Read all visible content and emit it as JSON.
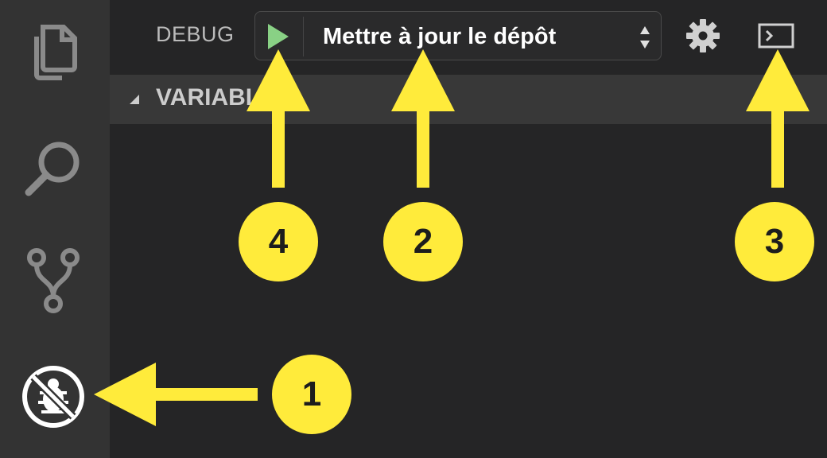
{
  "activity_bar": {
    "icons": [
      "files-icon",
      "search-icon",
      "source-control-icon",
      "debug-icon"
    ]
  },
  "debug_panel": {
    "title": "DEBUG",
    "config_selected": "Mettre à jour le dépôt",
    "section_title": "VARIABLES"
  },
  "callouts": {
    "c1": "1",
    "c2": "2",
    "c3": "3",
    "c4": "4"
  },
  "colors": {
    "activity_bar": "#333333",
    "sidebar": "#252526",
    "section_header": "#383838",
    "play_green": "#89d185",
    "callout_yellow": "#ffeb3b"
  }
}
